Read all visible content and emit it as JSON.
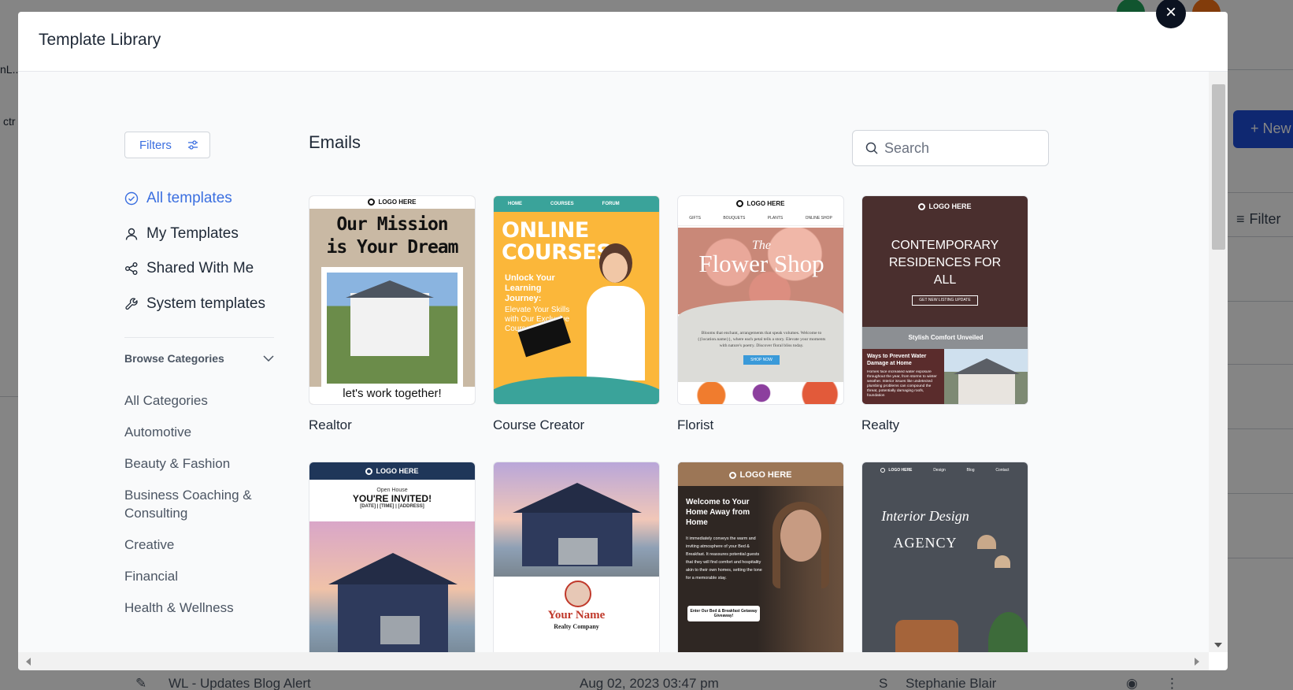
{
  "modal": {
    "title": "Template Library",
    "close_label": "×"
  },
  "sidebar": {
    "filters_label": "Filters",
    "nav": [
      {
        "label": "All templates",
        "icon": "check-circle-icon",
        "active": true
      },
      {
        "label": "My Templates",
        "icon": "user-icon",
        "active": false
      },
      {
        "label": "Shared With Me",
        "icon": "share-icon",
        "active": false
      },
      {
        "label": "System templates",
        "icon": "wrench-icon",
        "active": false
      }
    ],
    "browse_label": "Browse Categories",
    "categories": [
      "All Categories",
      "Automotive",
      "Beauty & Fashion",
      "Business Coaching & Consulting",
      "Creative",
      "Financial",
      "Health & Wellness"
    ]
  },
  "main": {
    "title": "Emails",
    "search_placeholder": "Search"
  },
  "templates": [
    {
      "name": "Realtor",
      "logo": "LOGO HERE",
      "headline": "Our Mission is Your Dream",
      "footer": "let's work together!"
    },
    {
      "name": "Course Creator",
      "nav": [
        "HOME",
        "COURSES",
        "FORUM"
      ],
      "headline": "ONLINE COURSES",
      "sub": "Unlock Your Learning Journey:",
      "sub2": "Elevate Your Skills with Our Exclusive Courses!"
    },
    {
      "name": "Florist",
      "logo": "LOGO HERE",
      "nav": [
        "GIFTS",
        "BOUQUETS",
        "PLANTS",
        "ONLINE SHOP"
      ],
      "small": "The",
      "headline": "Flower Shop",
      "body": "Blooms that enchant, arrangements that speak volumes. Welcome to {{location.name}}, where each petal tells a story. Elevate your moments with nature's poetry. Discover floral bliss today.",
      "cta": "SHOP NOW"
    },
    {
      "name": "Realty",
      "logo": "LOGO HERE",
      "headline": "CONTEMPORARY RESIDENCES FOR ALL",
      "cta": "GET NEW LISTING UPDATE",
      "band": "Stylish Comfort Unveiled",
      "sub": "Ways to Prevent Water Damage at Home",
      "body": "Homes face increased water exposure throughout the year, from storms to winter weather. Interior issues like undetected plumbing problems can compound the threat, potentially damaging roofs, foundation"
    },
    {
      "name": "",
      "logo": "LOGO HERE",
      "pre": "Open House",
      "headline": "YOU'RE INVITED!",
      "sub": "[DATE] | [TIME] | [ADDRESS]"
    },
    {
      "name": "",
      "headline": "Your Name",
      "sub": "Realty Company"
    },
    {
      "name": "",
      "logo": "LOGO HERE",
      "headline": "Welcome to Your Home Away from Home",
      "body": "It immediately conveys the warm and inviting atmosphere of your Bed & Breakfast. It reassures potential guests that they will find comfort and hospitality akin to their own homes, setting the tone for a memorable stay.",
      "cta": "Enter Our Bed & Breakfast Getaway Giveaway!"
    },
    {
      "name": "",
      "logo": "LOGO HERE",
      "nav": [
        "Design",
        "Blog",
        "Contact"
      ],
      "headline": "Interior Design",
      "sub": "AGENCY"
    }
  ],
  "background": {
    "frag1": "nL...",
    "frag2": "ctr",
    "new_button": "+ New",
    "filter_label": "Filter",
    "row_title": "WL - Updates Blog Alert",
    "row_date": "Aug 02, 2023 03:47 pm",
    "row_avatar": "S",
    "row_user": "Stephanie Blair"
  },
  "colors": {
    "accent": "#3b6fe0",
    "modal_bg": "#ffffff",
    "body_bg": "#f9fafb"
  }
}
